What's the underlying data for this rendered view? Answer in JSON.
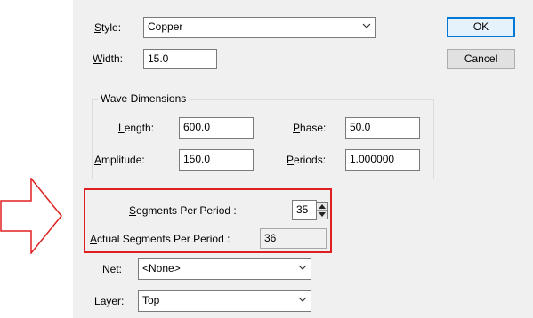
{
  "style": {
    "label": "Style:",
    "value": "Copper"
  },
  "width": {
    "label": "Width:",
    "value": "15.0"
  },
  "buttons": {
    "ok": "OK",
    "cancel": "Cancel"
  },
  "wave": {
    "title": "Wave Dimensions",
    "length": {
      "label": "Length:",
      "value": "600.0"
    },
    "phase": {
      "label": "Phase:",
      "value": "50.0"
    },
    "amplitude": {
      "label": "Amplitude:",
      "value": "150.0"
    },
    "periods": {
      "label": "Periods:",
      "value": "1.000000"
    }
  },
  "segments": {
    "per_period_label": "Segments Per Period :",
    "per_period_value": "35",
    "actual_label": "Actual Segments Per Period :",
    "actual_value": "36"
  },
  "net": {
    "label": "Net:",
    "value": "<None>"
  },
  "layer": {
    "label": "Layer:",
    "value": "Top"
  },
  "colors": {
    "highlight": "#e02020",
    "arrow": "#e02020",
    "default_button_border": "#0078d7"
  },
  "icons": {
    "callout_arrow": "right-arrow-outline-icon",
    "dropdown": "chevron-down-icon",
    "spinner": "spin-up-down-icon"
  }
}
